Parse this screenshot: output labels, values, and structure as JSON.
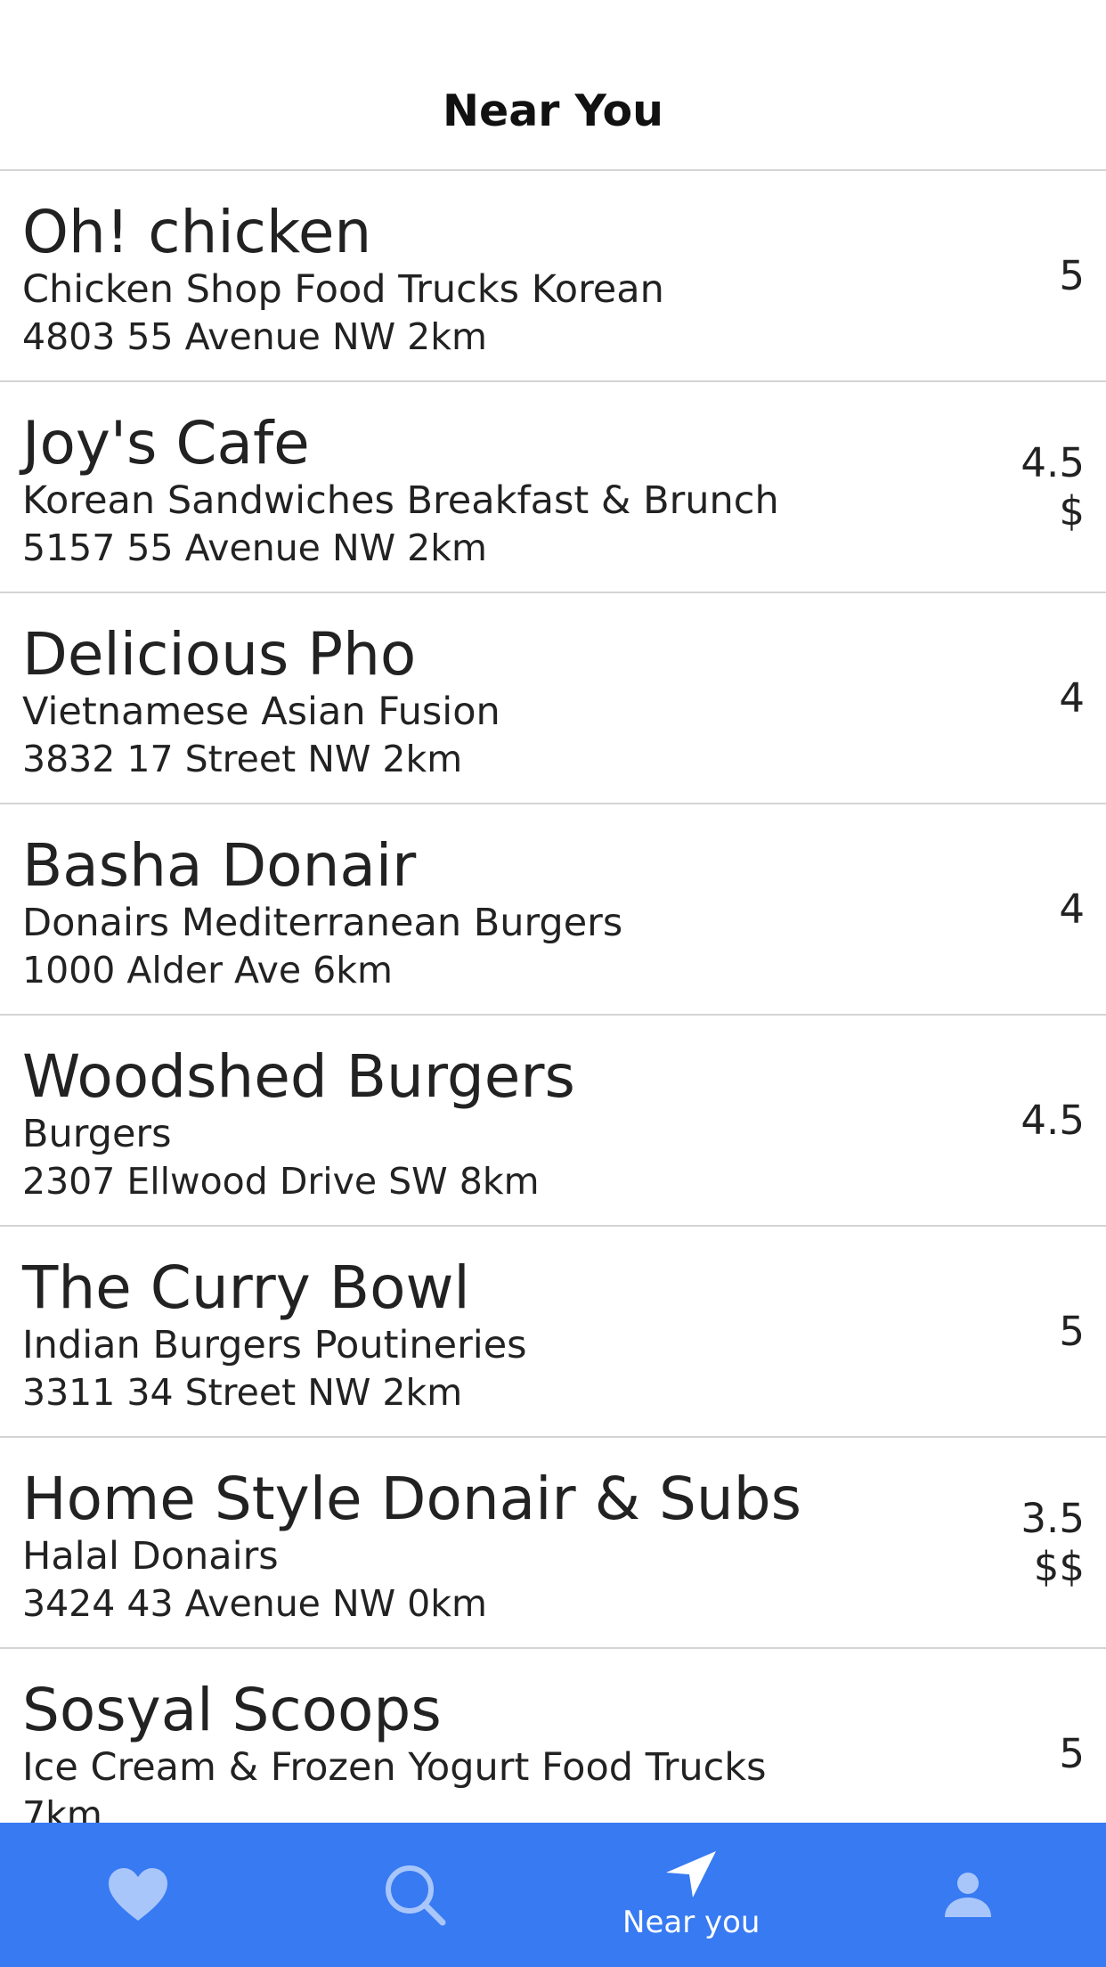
{
  "header": {
    "title": "Near You"
  },
  "restaurants": [
    {
      "name": "Oh! chicken",
      "categories": "Chicken Shop Food Trucks Korean",
      "address": "4803 55 Avenue NW 2km",
      "rating": "5",
      "price": ""
    },
    {
      "name": "Joy's Cafe",
      "categories": "Korean Sandwiches Breakfast & Brunch",
      "address": "5157 55 Avenue NW 2km",
      "rating": "4.5",
      "price": "$"
    },
    {
      "name": "Delicious Pho",
      "categories": "Vietnamese Asian Fusion",
      "address": "3832 17 Street NW 2km",
      "rating": "4",
      "price": ""
    },
    {
      "name": "Basha Donair",
      "categories": "Donairs Mediterranean Burgers",
      "address": "1000 Alder Ave 6km",
      "rating": "4",
      "price": ""
    },
    {
      "name": "Woodshed Burgers",
      "categories": "Burgers",
      "address": "2307 Ellwood Drive SW 8km",
      "rating": "4.5",
      "price": ""
    },
    {
      "name": "The Curry Bowl",
      "categories": "Indian Burgers Poutineries",
      "address": "3311 34 Street NW 2km",
      "rating": "5",
      "price": ""
    },
    {
      "name": "Home Style Donair & Subs",
      "categories": "Halal Donairs",
      "address": "3424 43 Avenue NW 0km",
      "rating": "3.5",
      "price": "$$"
    },
    {
      "name": "Sosyal Scoops",
      "categories": "Ice Cream & Frozen Yogurt Food Trucks",
      "address": " 7km",
      "rating": "5",
      "price": ""
    }
  ],
  "tabbar": {
    "background": "#377af2",
    "tabs": [
      {
        "icon": "heart-icon",
        "label": "",
        "active": false
      },
      {
        "icon": "search-icon",
        "label": "",
        "active": false
      },
      {
        "icon": "location-arrow-icon",
        "label": "Near you",
        "active": true
      },
      {
        "icon": "person-icon",
        "label": "",
        "active": false
      }
    ]
  }
}
